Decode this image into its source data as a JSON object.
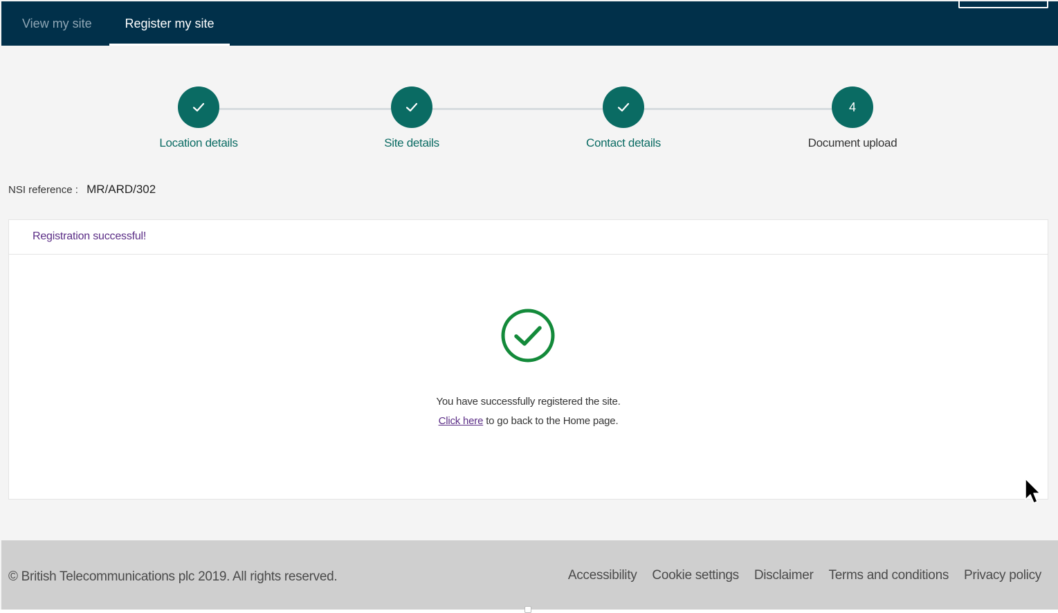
{
  "nav": {
    "tabs": [
      {
        "label": "View my site",
        "active": false
      },
      {
        "label": "Register my site",
        "active": true
      }
    ]
  },
  "stepper": {
    "steps": [
      {
        "label": "Location details",
        "state": "complete",
        "icon": "check-icon"
      },
      {
        "label": "Site details",
        "state": "complete",
        "icon": "check-icon"
      },
      {
        "label": "Contact details",
        "state": "complete",
        "icon": "check-icon"
      },
      {
        "label": "Document upload",
        "state": "current",
        "number": "4"
      }
    ]
  },
  "nsi": {
    "label": "NSI reference :",
    "value": "MR/ARD/302"
  },
  "panel": {
    "title": "Registration successful!",
    "message": "You have successfully registered the site.",
    "link_text": "Click here",
    "link_suffix": "to go back to the Home page."
  },
  "footer": {
    "copyright": "© British Telecommunications plc 2019. All rights reserved.",
    "links": [
      "Accessibility",
      "Cookie settings",
      "Disclaimer",
      "Terms and conditions",
      "Privacy policy"
    ]
  },
  "colors": {
    "nav_bg": "#01304a",
    "step_complete": "#0a6b63",
    "success_green": "#138a3a",
    "link_purple": "#5b2d86",
    "footer_bg": "#cfcfcf"
  }
}
